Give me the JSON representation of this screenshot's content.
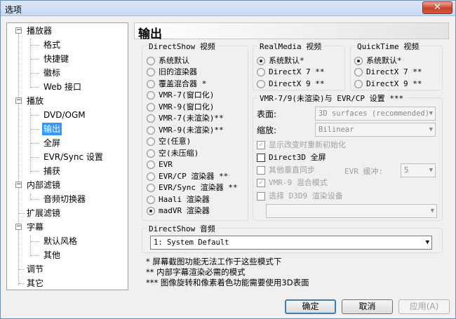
{
  "window": {
    "title": "选项",
    "close_glyph": "✕"
  },
  "tree": {
    "items": [
      {
        "label": "播放器",
        "level": 0,
        "expander": "−"
      },
      {
        "label": "格式",
        "level": 1
      },
      {
        "label": "快捷键",
        "level": 1
      },
      {
        "label": "徽标",
        "level": 1
      },
      {
        "label": "Web 接口",
        "level": 1
      },
      {
        "label": "播放",
        "level": 0,
        "expander": "−"
      },
      {
        "label": "DVD/OGM",
        "level": 1
      },
      {
        "label": "输出",
        "level": 1,
        "selected": true
      },
      {
        "label": "全屏",
        "level": 1
      },
      {
        "label": "EVR/Sync 设置",
        "level": 1
      },
      {
        "label": "捕获",
        "level": 1
      },
      {
        "label": "内部滤镜",
        "level": 0,
        "expander": "−"
      },
      {
        "label": "音频切换器",
        "level": 1
      },
      {
        "label": "扩展滤镜",
        "level": 0
      },
      {
        "label": "字幕",
        "level": 0,
        "expander": "−"
      },
      {
        "label": "默认风格",
        "level": 1
      },
      {
        "label": "其他",
        "level": 1
      },
      {
        "label": "调节",
        "level": 0
      },
      {
        "label": "其它",
        "level": 0
      }
    ]
  },
  "header": {
    "title": "输出"
  },
  "directshow_video": {
    "legend": "DirectShow 视频",
    "options": [
      {
        "label": "系统默认",
        "checked": false
      },
      {
        "label": "旧的渲染器",
        "checked": false
      },
      {
        "label": "覆盖混合器 *",
        "checked": false
      },
      {
        "label": "VMR-7(窗口化)",
        "checked": false
      },
      {
        "label": "VMR-9(窗口化)",
        "checked": false
      },
      {
        "label": "VMR-7(未渲染)**",
        "checked": false
      },
      {
        "label": "VMR-9(未渲染)**",
        "checked": false
      },
      {
        "label": "空(任意)",
        "checked": false
      },
      {
        "label": "空(未压缩)",
        "checked": false
      },
      {
        "label": "EVR",
        "checked": false
      },
      {
        "label": "EVR/CP 渲染器 **",
        "checked": false
      },
      {
        "label": "EVR/Sync 渲染器 **",
        "checked": false
      },
      {
        "label": "Haali 渲染器",
        "checked": false
      },
      {
        "label": "madVR 渲染器",
        "checked": true
      }
    ]
  },
  "realmedia_video": {
    "legend": "RealMedia 视频",
    "options": [
      {
        "label": "系统默认*",
        "checked": true
      },
      {
        "label": "DirectX 7 **",
        "checked": false
      },
      {
        "label": "DirectX 9 **",
        "checked": false
      }
    ]
  },
  "quicktime_video": {
    "legend": "QuickTime 视频",
    "options": [
      {
        "label": "系统默认*",
        "checked": true
      },
      {
        "label": "DirectX 7 **",
        "checked": false
      },
      {
        "label": "DirectX 9 **",
        "checked": false
      }
    ]
  },
  "vmr_settings": {
    "legend": "VMR-7/9(未渲染)与 EVR/CP 设置 ***",
    "surface_label": "表面:",
    "surface_value": "3D surfaces (recommended)",
    "resize_label": "缩放:",
    "resize_value": "Bilinear",
    "reinit_label": "显示改变时重新初始化",
    "d3d_fullscreen_label": "Direct3D 全屏",
    "vsync_label": "其他垂直同步",
    "evr_buffer_label": "EVR 缓冲:",
    "evr_buffer_value": "5",
    "vmr9_mixer_label": "VMR-9 混合模式",
    "d3d9_device_label": "选择 D3D9 渲染设备",
    "d3d9_device_value": ""
  },
  "directshow_audio": {
    "legend": "DirectShow 音频",
    "value": "1: System Default"
  },
  "notes": [
    "*  屏幕截图功能无法工作于这些模式下",
    "** 内部字幕渲染必需的模式",
    "*** 图像旋转和像素着色功能需要使用3D表面"
  ],
  "buttons": {
    "ok": "确定",
    "cancel": "取消",
    "apply": "应用(A)"
  },
  "icons": {
    "radio": "radio-icon",
    "checkbox": "checkbox-icon",
    "dropdown": "chevron-down-icon",
    "check_mark": "✓",
    "arrow": "▼"
  }
}
